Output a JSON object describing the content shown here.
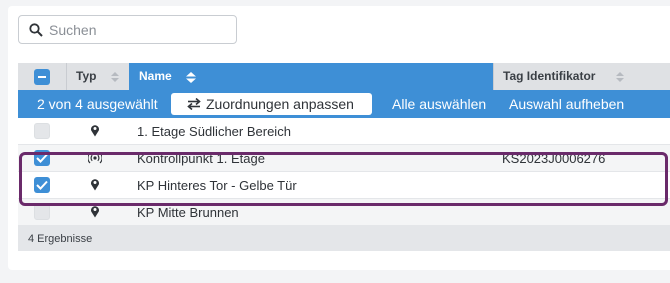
{
  "search": {
    "placeholder": "Suchen"
  },
  "table": {
    "columns": {
      "type": "Typ",
      "name": "Name",
      "tag": "Tag Identifikator"
    },
    "action_bar": {
      "selection_count": "2 von 4 ausgewählt",
      "adjust_button": "Zuordnungen anpassen",
      "select_all": "Alle auswählen",
      "deselect_all": "Auswahl aufheben"
    },
    "rows": [
      {
        "selected": false,
        "type_icon": "map-pin-icon",
        "name": "1. Etage Südlicher Bereich",
        "tag": ""
      },
      {
        "selected": true,
        "type_icon": "radio-tag-icon",
        "name": "Kontrollpunkt 1. Etage",
        "tag": "KS2023J0006276"
      },
      {
        "selected": true,
        "type_icon": "map-pin-icon",
        "name": "KP Hinteres Tor - Gelbe Tür",
        "tag": ""
      },
      {
        "selected": false,
        "type_icon": "map-pin-icon",
        "name": "KP Mitte Brunnen",
        "tag": ""
      }
    ],
    "footer": "4 Ergebnisse"
  },
  "colors": {
    "accent": "#3e8fd6",
    "highlight": "#6a2a6a"
  }
}
